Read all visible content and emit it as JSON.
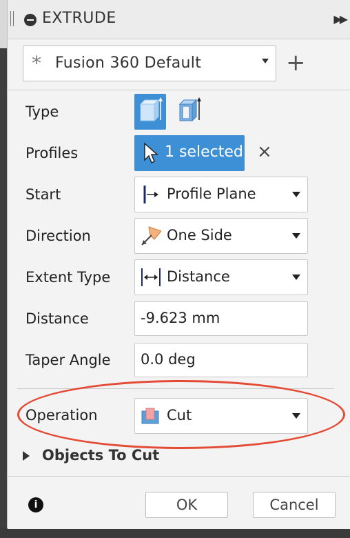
{
  "header": {
    "title": "EXTRUDE"
  },
  "preset": {
    "label": "Fusion 360 Default",
    "add_label": "+"
  },
  "rows": {
    "type": {
      "label": "Type"
    },
    "profiles": {
      "label": "Profiles",
      "selection": "1 selected",
      "clear": "×"
    },
    "start": {
      "label": "Start",
      "value": "Profile Plane"
    },
    "direction": {
      "label": "Direction",
      "value": "One Side"
    },
    "extent_type": {
      "label": "Extent Type",
      "value": "Distance"
    },
    "distance": {
      "label": "Distance",
      "value": "-9.623 mm"
    },
    "taper_angle": {
      "label": "Taper Angle",
      "value": "0.0 deg"
    },
    "operation": {
      "label": "Operation",
      "value": "Cut"
    }
  },
  "objects_to_cut": {
    "label": "Objects To Cut"
  },
  "footer": {
    "ok_label": "OK",
    "cancel_label": "Cancel"
  },
  "colors": {
    "accent": "#3d8fd6",
    "annotation": "#e34b35"
  }
}
